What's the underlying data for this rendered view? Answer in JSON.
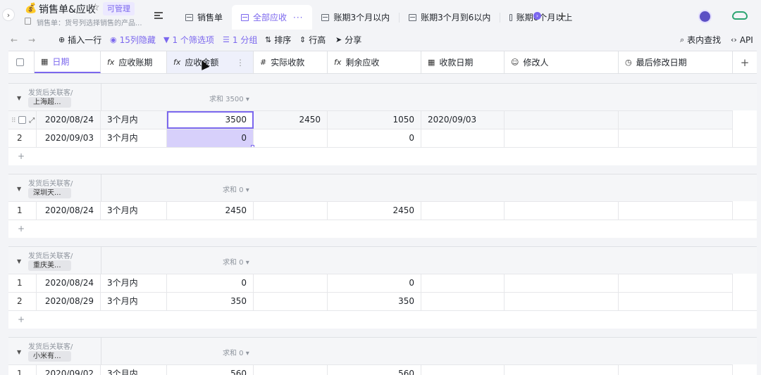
{
  "header": {
    "emoji": "💰",
    "title": "销售单&应收",
    "star": "☆",
    "permission": "可管理",
    "description": "销售单：货号列选择销售的产品..."
  },
  "tabs": [
    {
      "label": "销售单"
    },
    {
      "label": "全部应收",
      "more": "···"
    },
    {
      "label": "账期3个月以内"
    },
    {
      "label": "账期3个月到6以内"
    },
    {
      "label": "账期6个月以上"
    }
  ],
  "toolbar": {
    "undo": "←",
    "redo": "→",
    "insert_row": "插入一行",
    "hidden_cols": "15列隐藏",
    "filter": "1 个筛选项",
    "group": "1 分组",
    "sort": "排序",
    "row_height": "行高",
    "share": "分享",
    "search": "表内查找",
    "api": "API"
  },
  "columns": [
    {
      "label": "日期",
      "icon": "calendar-icon"
    },
    {
      "label": "应收账期",
      "icon": "formula-icon"
    },
    {
      "label": "应收金额",
      "icon": "formula-icon"
    },
    {
      "label": "实际收款",
      "icon": "number-icon"
    },
    {
      "label": "剩余应收",
      "icon": "formula-icon"
    },
    {
      "label": "收款日期",
      "icon": "calendar-icon"
    },
    {
      "label": "修改人",
      "icon": "user-icon"
    },
    {
      "label": "最后修改日期",
      "icon": "clock-icon"
    }
  ],
  "groups": [
    {
      "label": "发货后关联客/",
      "chip": "上海超...",
      "sum": "求和 3500",
      "rows": [
        {
          "n": "",
          "date": "2020/08/24",
          "term": "3个月内",
          "amount": "3500",
          "received": "2450",
          "remain": "1050",
          "recv_date": "2020/09/03"
        },
        {
          "n": "2",
          "date": "2020/09/03",
          "term": "3个月内",
          "amount": "0",
          "received": "",
          "remain": "0",
          "recv_date": ""
        }
      ]
    },
    {
      "label": "发货后关联客/",
      "chip": "深圳天...",
      "sum": "求和 0",
      "rows": [
        {
          "n": "1",
          "date": "2020/08/24",
          "term": "3个月内",
          "amount": "2450",
          "received": "",
          "remain": "2450",
          "recv_date": ""
        }
      ]
    },
    {
      "label": "发货后关联客/",
      "chip": "重庆美...",
      "sum": "求和 0",
      "rows": [
        {
          "n": "1",
          "date": "2020/08/24",
          "term": "3个月内",
          "amount": "0",
          "received": "",
          "remain": "0",
          "recv_date": ""
        },
        {
          "n": "2",
          "date": "2020/08/29",
          "term": "3个月内",
          "amount": "350",
          "received": "",
          "remain": "350",
          "recv_date": ""
        }
      ]
    },
    {
      "label": "发货后关联客/",
      "chip": "小米有...",
      "sum": "求和 0",
      "rows": [
        {
          "n": "1",
          "date": "2020/09/02",
          "term": "3个月内",
          "amount": "560",
          "received": "",
          "remain": "560",
          "recv_date": ""
        }
      ]
    }
  ],
  "add_row_symbol": "+",
  "add_column_symbol": "+",
  "accent_color": "#7b67ee"
}
